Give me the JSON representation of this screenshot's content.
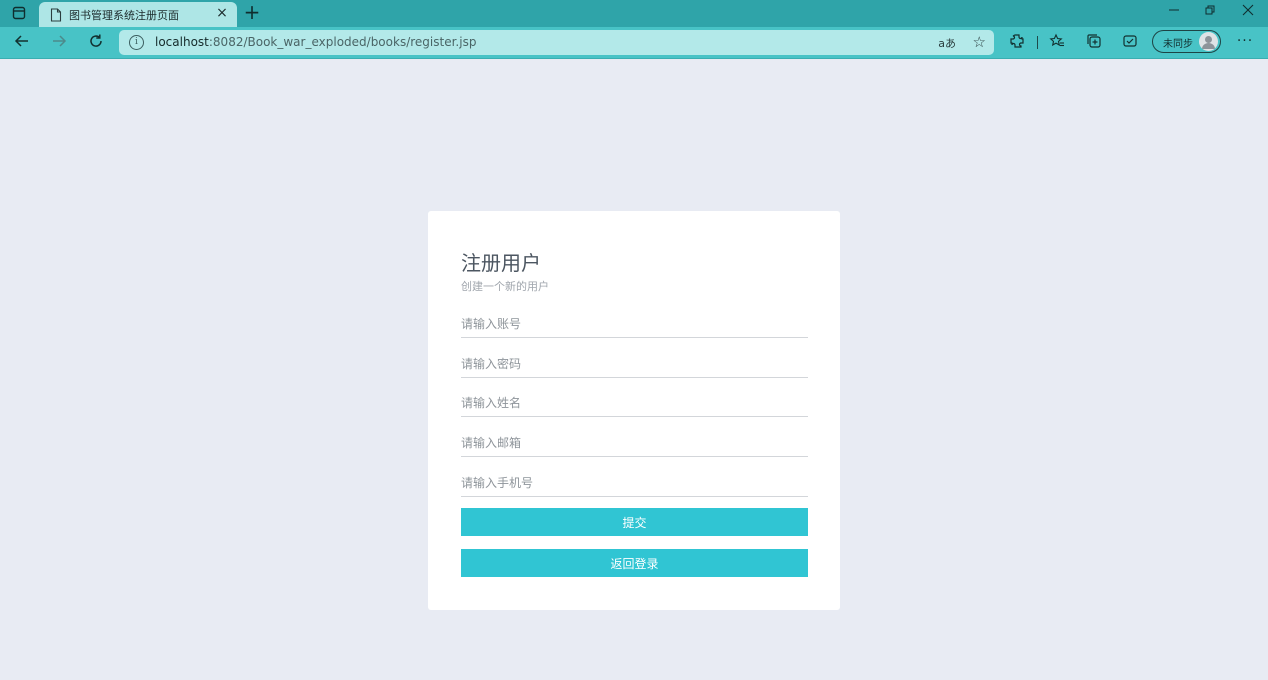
{
  "browser": {
    "tab_title": "图书管理系统注册页面",
    "new_tab_symbol": "+",
    "close_symbol": "×",
    "url_host": "localhost",
    "url_rest": ":8082/Book_war_exploded/books/register.jsp",
    "read_aloud": "aあ",
    "sync_label": "未同步",
    "more_symbol": "···",
    "colors": {
      "tabbar": "#2fa4a9",
      "toolbar": "#48c3c6",
      "addressbar": "#b3e9e9"
    }
  },
  "register": {
    "title": "注册用户",
    "subtitle": "创建一个新的用户",
    "placeholders": {
      "account": "请输入账号",
      "password": "请输入密码",
      "name": "请输入姓名",
      "email": "请输入邮箱",
      "phone": "请输入手机号"
    },
    "submit_label": "提交",
    "back_label": "返回登录",
    "colors": {
      "button": "#30c5d3",
      "page_bg": "#e8ebf3",
      "card": "#ffffff"
    }
  }
}
